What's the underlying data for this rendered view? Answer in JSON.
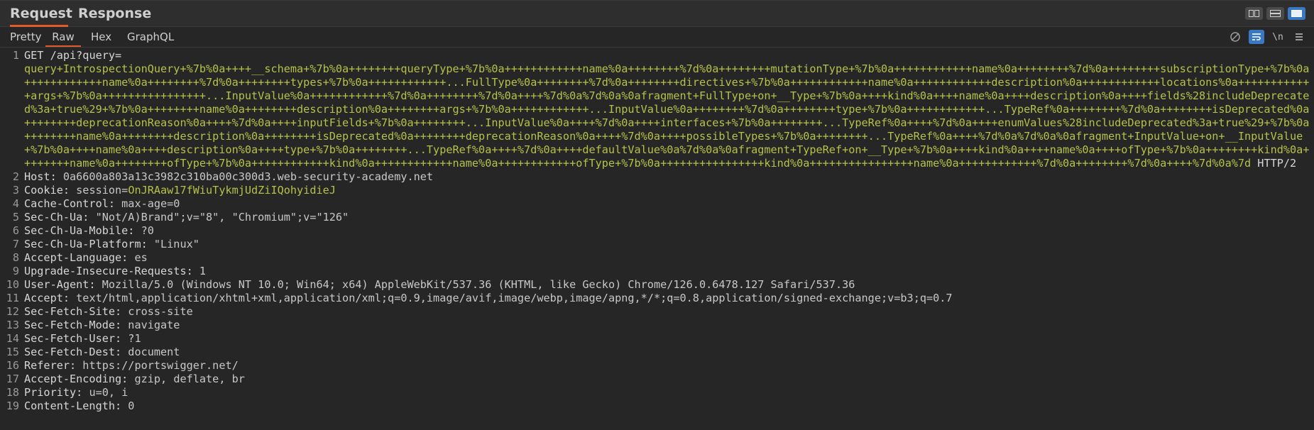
{
  "tabs": {
    "request": "Request",
    "response": "Response"
  },
  "subtabs": {
    "pretty": "Pretty",
    "raw": "Raw",
    "hex": "Hex",
    "graphql": "GraphQL"
  },
  "tools": {
    "newline": "\\n"
  },
  "request": {
    "method": "GET",
    "path": "/api?query=",
    "query_value": "query+IntrospectionQuery+%7b%0a++++__schema+%7b%0a++++++++queryType+%7b%0a++++++++++++name%0a++++++++%7d%0a++++++++mutationType+%7b%0a++++++++++++name%0a++++++++%7d%0a++++++++subscriptionType+%7b%0a++++++++++++name%0a++++++++%7d%0a++++++++types+%7b%0a++++++++++++...FullType%0a++++++++%7d%0a++++++++directives+%7b%0a++++++++++++name%0a++++++++++++description%0a++++++++++++locations%0a++++++++++++args+%7b%0a++++++++++++++++...InputValue%0a++++++++++++%7d%0a++++++++%7d%0a++++%7d%0a%7d%0a%0afragment+FullType+on+__Type+%7b%0a++++kind%0a++++name%0a++++description%0a++++fields%28includeDeprecated%3a+true%29+%7b%0a++++++++name%0a++++++++description%0a++++++++args+%7b%0a++++++++++++...InputValue%0a++++++++%7d%0a++++++++type+%7b%0a++++++++++++...TypeRef%0a++++++++%7d%0a++++++++isDeprecated%0a++++++++deprecationReason%0a++++%7d%0a++++inputFields+%7b%0a++++++++...InputValue%0a++++%7d%0a++++interfaces+%7b%0a++++++++...TypeRef%0a++++%7d%0a++++enumValues%28includeDeprecated%3a+true%29+%7b%0a++++++++name%0a++++++++description%0a++++++++isDeprecated%0a++++++++deprecationReason%0a++++%7d%0a++++possibleTypes+%7b%0a++++++++...TypeRef%0a++++%7d%0a%7d%0a%0afragment+InputValue+on+__InputValue+%7b%0a++++name%0a++++description%0a++++type+%7b%0a++++++++...TypeRef%0a++++%7d%0a++++defaultValue%0a%7d%0a%0afragment+TypeRef+on+__Type+%7b%0a++++kind%0a++++name%0a++++ofType+%7b%0a++++++++kind%0a++++++++name%0a++++++++ofType+%7b%0a++++++++++++kind%0a++++++++++++name%0a++++++++++++ofType+%7b%0a++++++++++++++++kind%0a++++++++++++++++name%0a++++++++++++%7d%0a++++++++%7d%0a++++%7d%0a%7d",
    "protocol": " HTTP/2",
    "headers": [
      {
        "n": "2",
        "name": "Host:",
        "value": " 0a6600a803a13c3982c310ba00c300d3.web-security-academy.net"
      },
      {
        "n": "3",
        "name": "Cookie:",
        "value": " session=",
        "cookie": "OnJRAaw17fWiuTykmjUdZiIQohyidieJ"
      },
      {
        "n": "4",
        "name": "Cache-Control:",
        "value": " max-age=0"
      },
      {
        "n": "5",
        "name": "Sec-Ch-Ua:",
        "value": " \"Not/A)Brand\";v=\"8\", \"Chromium\";v=\"126\""
      },
      {
        "n": "6",
        "name": "Sec-Ch-Ua-Mobile:",
        "value": " ?0"
      },
      {
        "n": "7",
        "name": "Sec-Ch-Ua-Platform:",
        "value": " \"Linux\""
      },
      {
        "n": "8",
        "name": "Accept-Language:",
        "value": " es"
      },
      {
        "n": "9",
        "name": "Upgrade-Insecure-Requests:",
        "value": " 1"
      },
      {
        "n": "10",
        "name": "User-Agent:",
        "value": " Mozilla/5.0 (Windows NT 10.0; Win64; x64) AppleWebKit/537.36 (KHTML, like Gecko) Chrome/126.0.6478.127 Safari/537.36"
      },
      {
        "n": "11",
        "name": "Accept:",
        "value": " text/html,application/xhtml+xml,application/xml;q=0.9,image/avif,image/webp,image/apng,*/*;q=0.8,application/signed-exchange;v=b3;q=0.7"
      },
      {
        "n": "12",
        "name": "Sec-Fetch-Site:",
        "value": " cross-site"
      },
      {
        "n": "13",
        "name": "Sec-Fetch-Mode:",
        "value": " navigate"
      },
      {
        "n": "14",
        "name": "Sec-Fetch-User:",
        "value": " ?1"
      },
      {
        "n": "15",
        "name": "Sec-Fetch-Dest:",
        "value": " document"
      },
      {
        "n": "16",
        "name": "Referer:",
        "value": " https://portswigger.net/"
      },
      {
        "n": "17",
        "name": "Accept-Encoding:",
        "value": " gzip, deflate, br"
      },
      {
        "n": "18",
        "name": "Priority:",
        "value": " u=0, i"
      },
      {
        "n": "19",
        "name": "Content-Length:",
        "value": " 0"
      }
    ]
  }
}
